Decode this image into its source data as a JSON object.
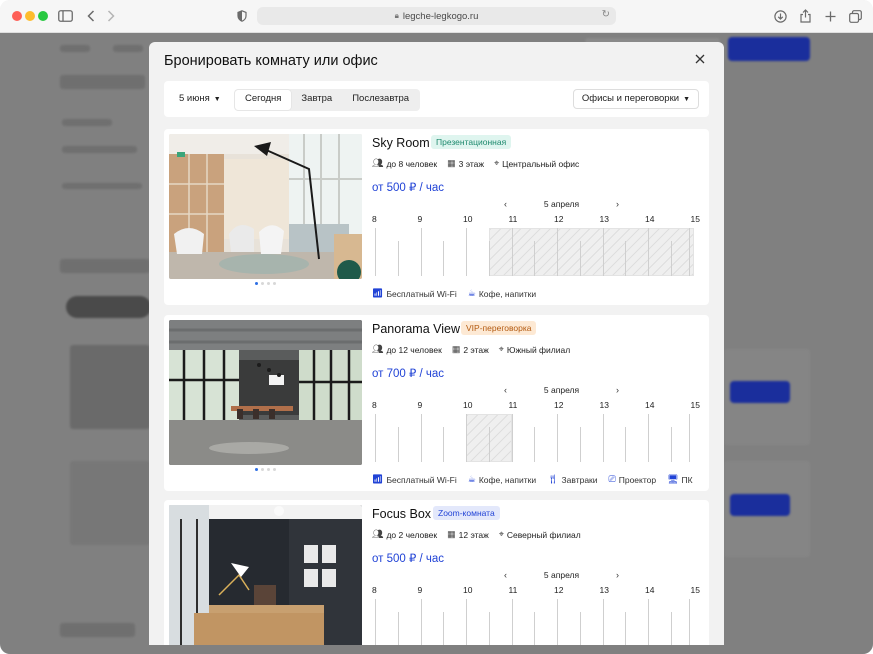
{
  "browser": {
    "url": "legche-legkogo.ru"
  },
  "modal": {
    "title": "Бронировать комнату или офис",
    "close_icon": "close-icon"
  },
  "filters": {
    "date": "5 июня",
    "tabs": [
      "Сегодня",
      "Завтра",
      "Послезавтра"
    ],
    "active_tab": "Сегодня",
    "type": "Офисы и переговорки"
  },
  "hours": [
    "8",
    "9",
    "10",
    "11",
    "12",
    "13",
    "14",
    "15"
  ],
  "rooms": [
    {
      "name": "Sky Room",
      "badge": "Презентационная",
      "badge_color": "#dff5ef",
      "badge_text_color": "#1f8a6e",
      "capacity": "до 8 человек",
      "floor": "3 этаж",
      "location": "Центральный офис",
      "price": "от 500 ₽ / час",
      "day": "5 апреля",
      "booked_hours": [
        [
          10.5,
          15
        ]
      ],
      "amenities": [
        {
          "icon": "wifi-icon",
          "label": "Бесплатный Wi-Fi"
        },
        {
          "icon": "coffee-icon",
          "label": "Кофе, напитки"
        }
      ]
    },
    {
      "name": "Panorama View",
      "badge": "VIP-переговорка",
      "badge_color": "#fde9d4",
      "badge_text_color": "#b35a10",
      "capacity": "до 12 человек",
      "floor": "2 этаж",
      "location": "Южный филиал",
      "price": "от 700 ₽ / час",
      "day": "5 апреля",
      "booked_hours": [
        [
          10,
          11
        ]
      ],
      "amenities": [
        {
          "icon": "wifi-icon",
          "label": "Бесплатный Wi-Fi"
        },
        {
          "icon": "coffee-icon",
          "label": "Кофе, напитки"
        },
        {
          "icon": "fork-knife-icon",
          "label": "Завтраки"
        },
        {
          "icon": "projector-icon",
          "label": "Проектор"
        },
        {
          "icon": "monitor-icon",
          "label": "ПК"
        }
      ]
    },
    {
      "name": "Focus Box",
      "badge": "Zoom-комната",
      "badge_color": "#e3e8fb",
      "badge_text_color": "#2143d6",
      "capacity": "до 2 человек",
      "floor": "12 этаж",
      "location": "Северный филиал",
      "price": "от 500 ₽ / час",
      "day": "5 апреля",
      "booked_hours": [],
      "amenities": []
    }
  ]
}
